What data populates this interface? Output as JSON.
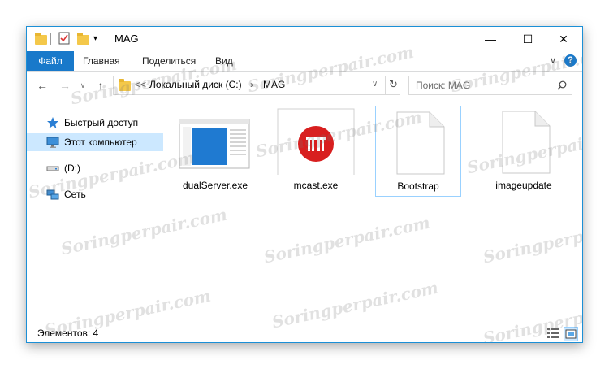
{
  "window": {
    "title": "MAG"
  },
  "ribbon": {
    "tabs": [
      "Файл",
      "Главная",
      "Поделиться",
      "Вид"
    ],
    "help_label": "?"
  },
  "address": {
    "prefix": "<<",
    "path": [
      "Локальный диск (C:)",
      "MAG"
    ]
  },
  "search": {
    "placeholder": "Поиск: MAG"
  },
  "nav": {
    "items": [
      {
        "label": "Быстрый доступ",
        "icon": "star-icon"
      },
      {
        "label": "Этот компьютер",
        "icon": "computer-icon",
        "selected": true
      },
      {
        "label": "(D:)",
        "icon": "drive-icon"
      },
      {
        "label": "Сеть",
        "icon": "network-icon"
      }
    ]
  },
  "files": [
    {
      "name": "dualServer.exe",
      "icon": "app-window-icon"
    },
    {
      "name": "mcast.exe",
      "icon": "red-logo-icon"
    },
    {
      "name": "Bootstrap",
      "icon": "blank-document-icon",
      "selected": true
    },
    {
      "name": "imageupdate",
      "icon": "blank-document-icon"
    }
  ],
  "status": {
    "item_count": "Элементов: 4"
  },
  "watermark": "Soringperpair.com",
  "colors": {
    "accent": "#1979ca",
    "selection": "#cce8ff",
    "folder": "#f4c84a",
    "mcast_red": "#d81f1f"
  }
}
